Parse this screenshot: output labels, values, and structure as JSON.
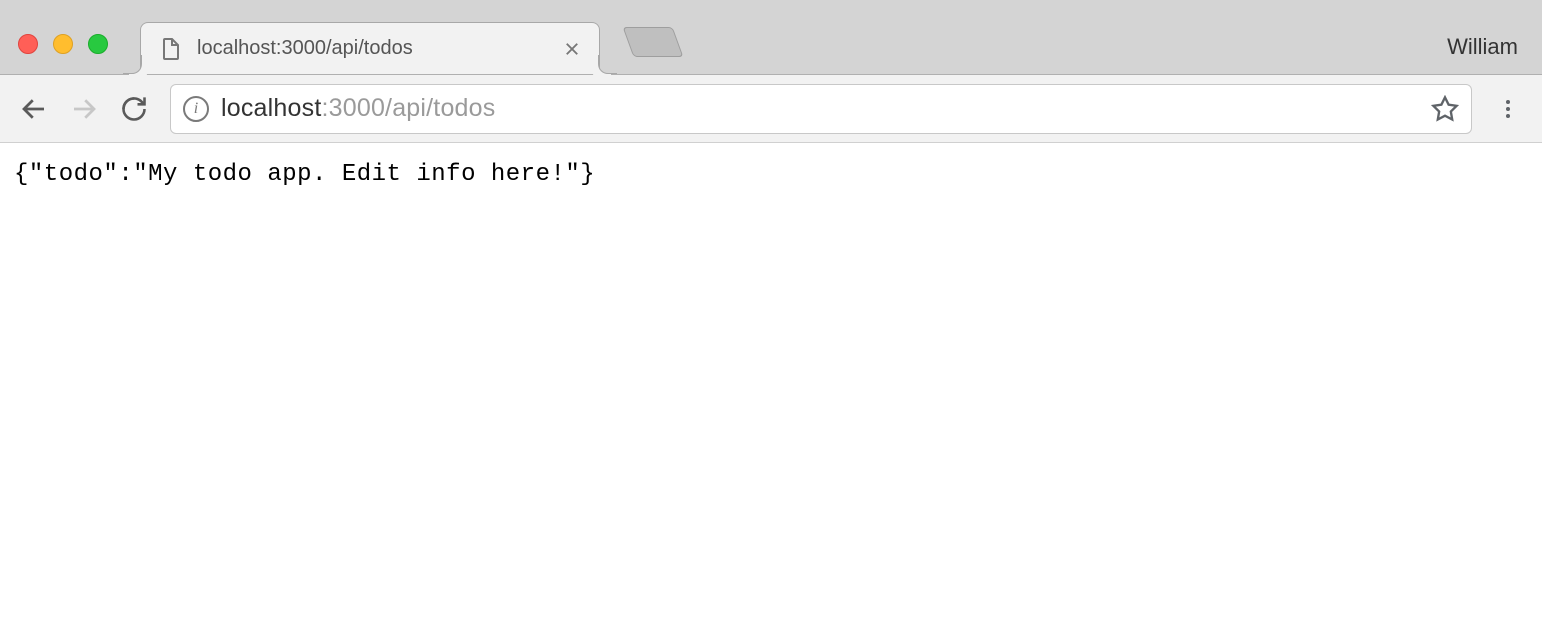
{
  "window": {
    "profile_name": "William"
  },
  "tab": {
    "title": "localhost:3000/api/todos"
  },
  "address": {
    "host_prefix": "localhost",
    "host_suffix": ":3000/api/todos"
  },
  "page": {
    "body_text": "{\"todo\":\"My todo app. Edit info here!\"}"
  },
  "icons": {
    "info_glyph": "i"
  }
}
